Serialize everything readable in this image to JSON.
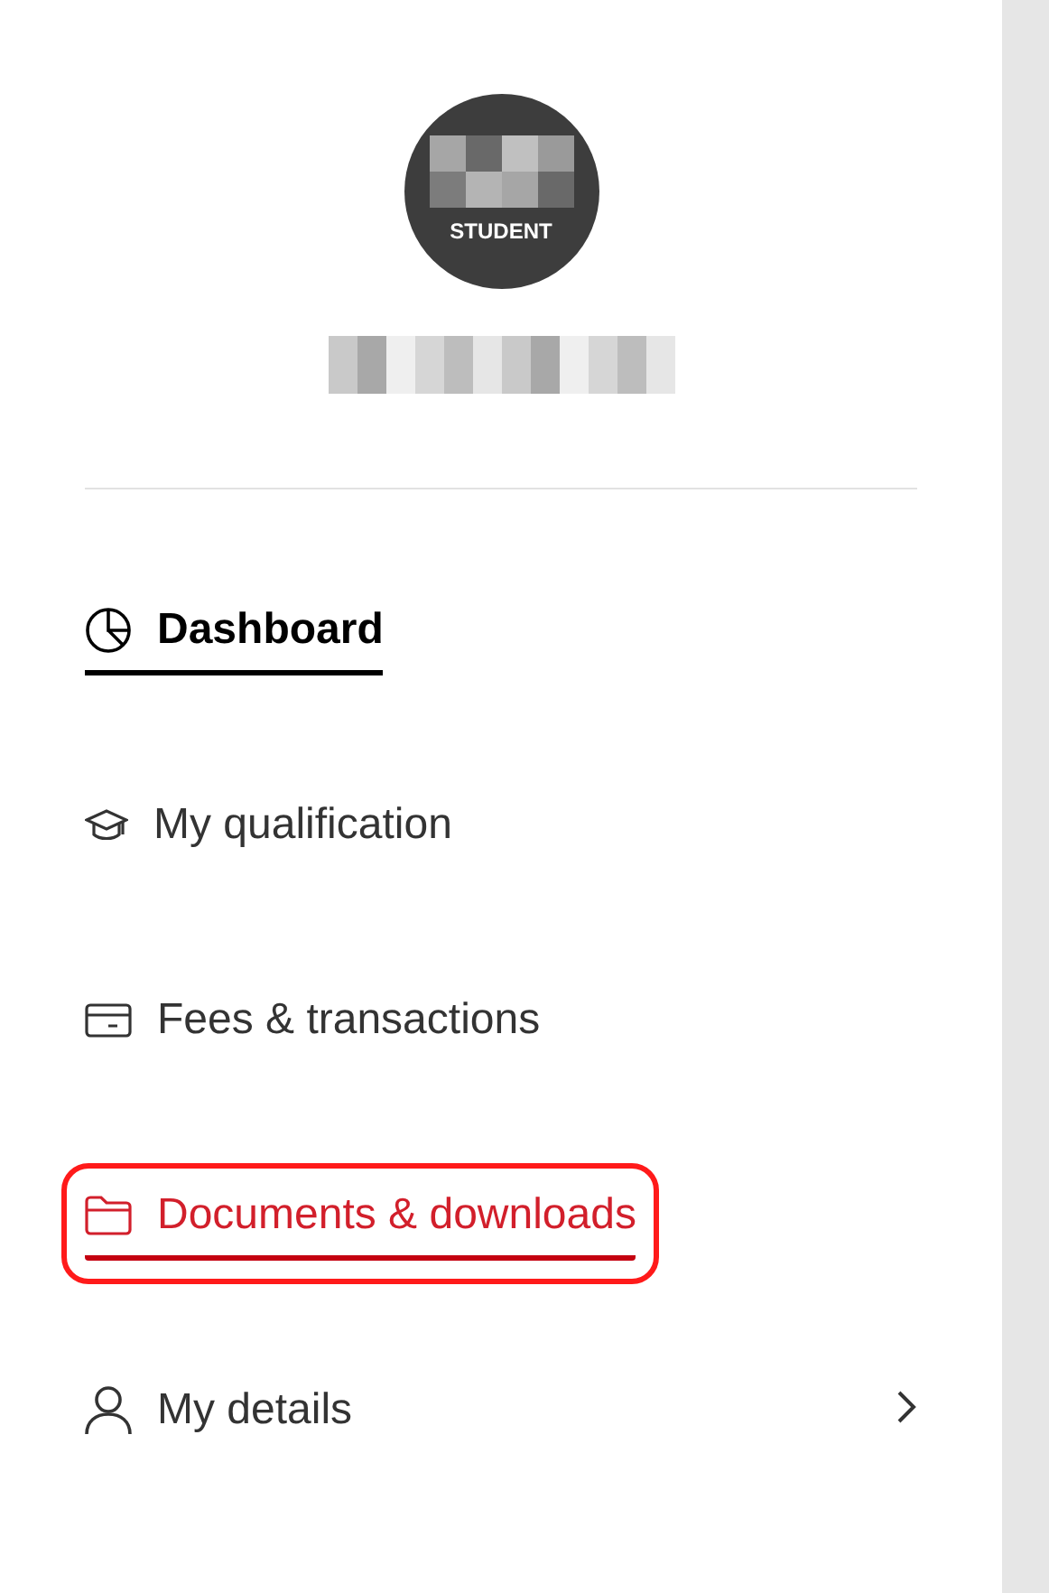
{
  "profile": {
    "avatar_label": "STUDENT"
  },
  "menu": [
    {
      "label": "Dashboard",
      "selected": true,
      "highlighted": false,
      "has_submenu": false
    },
    {
      "label": "My qualification",
      "selected": false,
      "highlighted": false,
      "has_submenu": false
    },
    {
      "label": "Fees & transactions",
      "selected": false,
      "highlighted": false,
      "has_submenu": false
    },
    {
      "label": "Documents & downloads",
      "selected": false,
      "highlighted": true,
      "has_submenu": false
    },
    {
      "label": "My details",
      "selected": false,
      "highlighted": false,
      "has_submenu": true
    }
  ]
}
